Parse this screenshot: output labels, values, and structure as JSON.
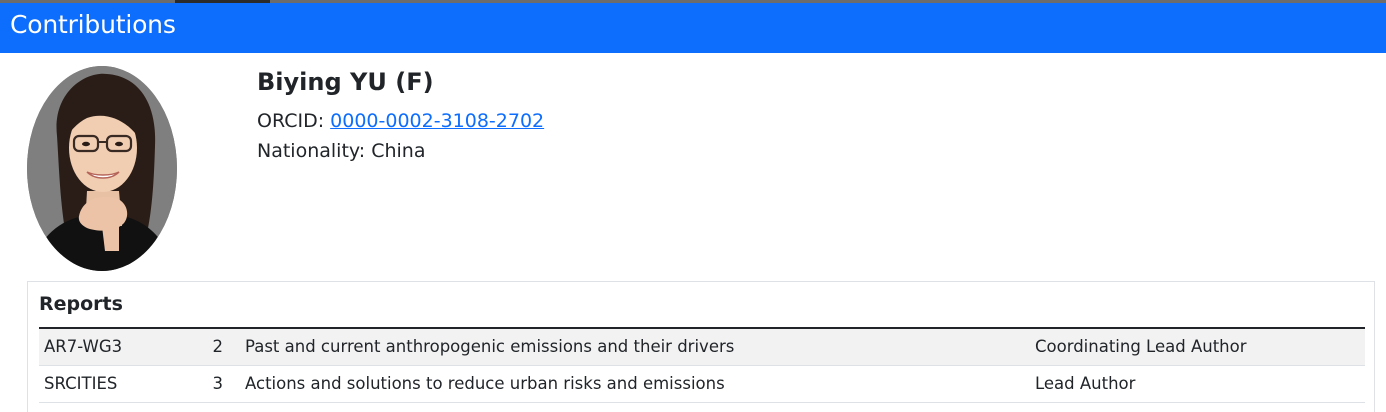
{
  "header": {
    "title": "Contributions",
    "accent_color": "#0d6efd"
  },
  "profile": {
    "photo_icon": "person-portrait",
    "name": "Biying YU (F)",
    "orcid_label": "ORCID: ",
    "orcid_value": "0000-0002-3108-2702",
    "nationality_label": "Nationality: ",
    "nationality_value": "China"
  },
  "reports": {
    "title": "Reports",
    "rows": [
      {
        "report": "AR7-WG3",
        "chapter": "2",
        "chapter_title": "Past and current anthropogenic emissions and their drivers",
        "role": "Coordinating Lead Author"
      },
      {
        "report": "SRCITIES",
        "chapter": "3",
        "chapter_title": "Actions and solutions to reduce urban risks and emissions",
        "role": "Lead Author"
      }
    ]
  }
}
